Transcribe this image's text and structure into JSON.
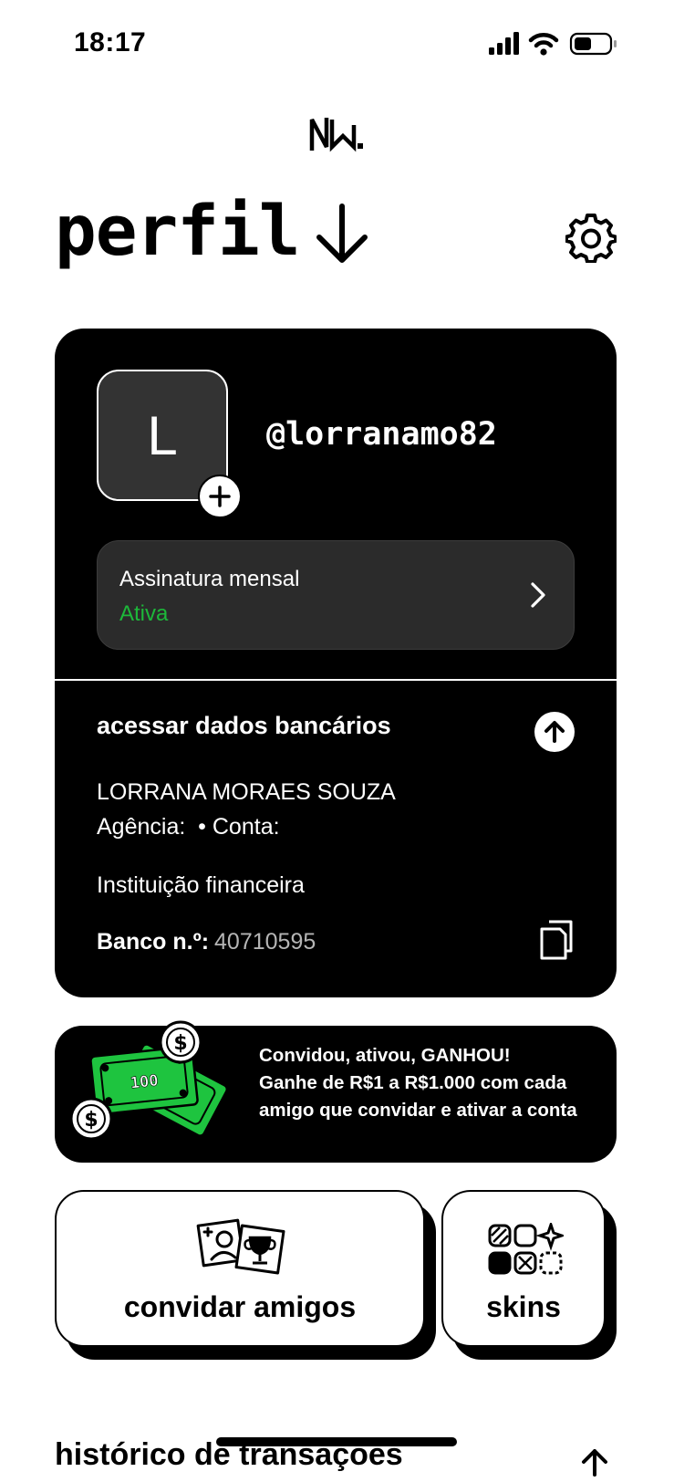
{
  "status_bar": {
    "time": "18:17",
    "icons": [
      "signal-icon",
      "wifi-icon",
      "battery-icon"
    ]
  },
  "header": {
    "logo_icon": "ng-logo",
    "title": "perfil",
    "title_icon": "arrow-down-icon",
    "settings_icon": "gear-icon"
  },
  "profile": {
    "avatar_initial": "L",
    "username": "@lorranamo82",
    "subscription": {
      "title": "Assinatura mensal",
      "status": "Ativa",
      "status_color": "#1db83a"
    }
  },
  "bank": {
    "heading": "acessar dados bancários",
    "name": "LORRANA MORAES SOUZA",
    "agency_line": "Agência:  • Conta:",
    "institution": "Instituição financeira",
    "number_label": "Banco n.º:",
    "number_value": "40710595"
  },
  "promo": {
    "line1": "Convidou, ativou, GANHOU!",
    "line2": "Ganhe de R$1 a R$1.000 com cada amigo que convidar e ativar a conta",
    "bill_value": "100",
    "accent_color": "#1ec43f"
  },
  "actions": {
    "invite_label": "convidar amigos",
    "skins_label": "skins"
  },
  "history": {
    "title": "histórico de transações"
  }
}
